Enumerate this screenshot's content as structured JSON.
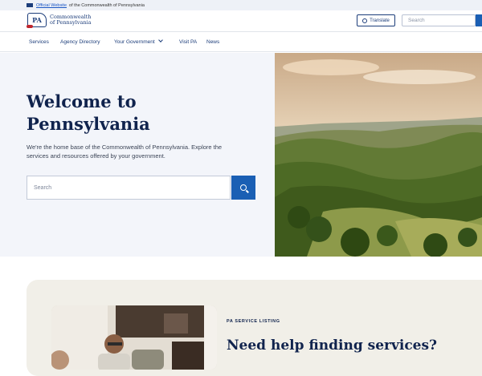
{
  "banner": {
    "link_text": "Official Website",
    "text": "of the Commonwealth of Pennsylvania"
  },
  "header": {
    "logo_mark": "PA",
    "logo_line1": "Commonwealth",
    "logo_line2": "of Pennsylvania",
    "translate_label": "Translate",
    "search_placeholder": "Search"
  },
  "nav": {
    "items": [
      {
        "label": "Services"
      },
      {
        "label": "Agency Directory"
      },
      {
        "label": "Your Government"
      },
      {
        "label": "Visit PA"
      },
      {
        "label": "News"
      }
    ]
  },
  "hero": {
    "title": "Welcome to Pennsylvania",
    "subtitle": "We're the home base of the Commonwealth of Pennsylvania. Explore the services and resources offered by your government.",
    "search_placeholder": "Search"
  },
  "service": {
    "label": "PA SERVICE LISTING",
    "title": "Need help finding services?"
  },
  "icons": [
    "flag-icon",
    "globe-icon",
    "search-icon",
    "chevron-down-icon"
  ],
  "colors": {
    "brand_navy": "#10234d",
    "accent_blue": "#1a5fb4",
    "hero_bg": "#f3f5fa",
    "card_bg": "#f1efe8"
  }
}
